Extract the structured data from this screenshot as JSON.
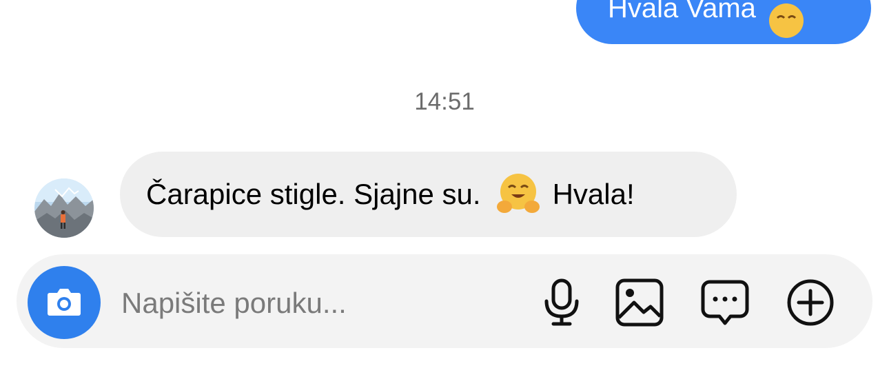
{
  "outgoing_message": {
    "text": "Hvala Vama",
    "emoji": "smiling-face-emoji"
  },
  "timestamp": "14:51",
  "incoming_message": {
    "text_before": "Čarapice stigle. Sjajne su.",
    "emoji": "hugging-face-emoji",
    "text_after": "Hvala!"
  },
  "composer": {
    "placeholder": "Napišite poruku...",
    "value": "",
    "icons": [
      "camera-icon",
      "microphone-icon",
      "gallery-icon",
      "sticker-icon",
      "plus-icon"
    ]
  },
  "colors": {
    "accent": "#3a86f7",
    "incoming_bubble": "#efefef",
    "composer_bg": "#f3f3f3",
    "timestamp": "#6b6b6b"
  }
}
